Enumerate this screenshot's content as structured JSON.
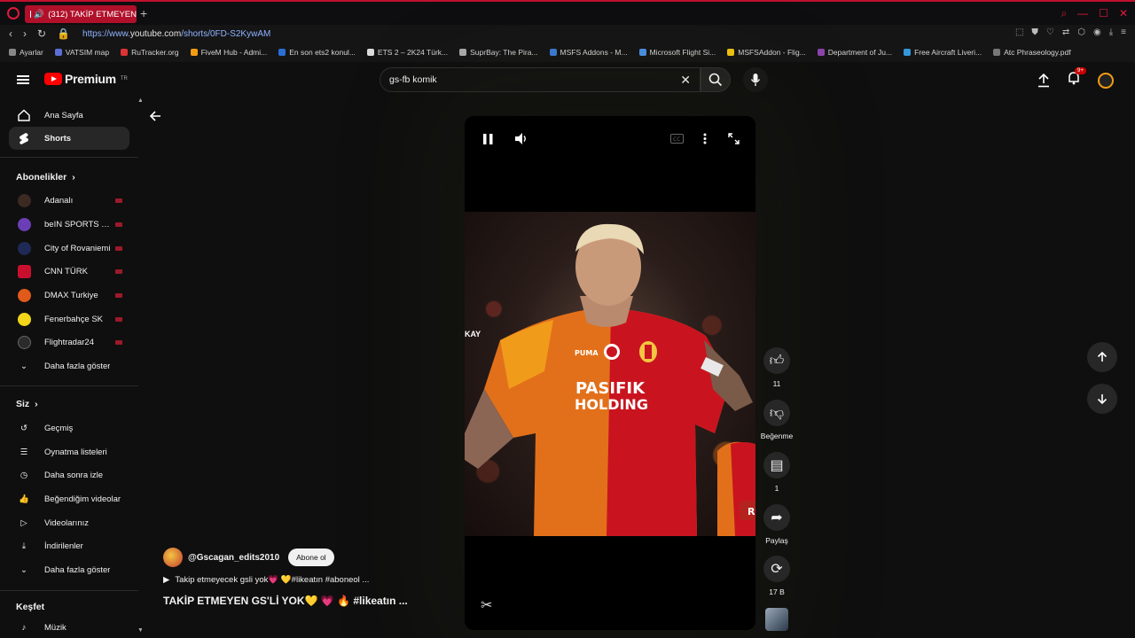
{
  "browser": {
    "tab_title": "(312) TAKİP ETMEYEN",
    "new_tab": "+",
    "url_scheme": "https://www.",
    "url_host": "youtube.com",
    "url_path": "/shorts/0FD-S2KywAM",
    "bookmarks": [
      "Ayarlar",
      "VATSIM map",
      "RuTracker.org",
      "FiveM Hub - Admi...",
      "En son ets2 konul...",
      "ETS 2 – 2K24 Türk...",
      "SuprBay: The Pira...",
      "MSFS Addons - M...",
      "Microsoft Flight Si...",
      "MSFSAddon - Flig...",
      "Department of Ju...",
      "Free Aircraft Liveri...",
      "Atc Phraseology.pdf"
    ]
  },
  "header": {
    "logo_text": "Premium",
    "logo_region": "TR",
    "search_value": "gs-fb komik",
    "notif_count": "9+"
  },
  "sidebar": {
    "home": "Ana Sayfa",
    "shorts": "Shorts",
    "subs_title": "Abonelikler",
    "channels": [
      {
        "name": "Adanalı",
        "color": "#3b2a22"
      },
      {
        "name": "beIN SPORTS Tü...",
        "color": "#6a3fb5"
      },
      {
        "name": "City of Rovaniemi",
        "color": "#1e2a55"
      },
      {
        "name": "CNN TÜRK",
        "color": "#c8102e"
      },
      {
        "name": "DMAX Turkiye",
        "color": "#e05a1b"
      },
      {
        "name": "Fenerbahçe SK",
        "color": "#f3d51a"
      },
      {
        "name": "Flightradar24",
        "color": "#2b2b2b"
      }
    ],
    "show_more": "Daha fazla göster",
    "you_title": "Siz",
    "you_items": [
      "Geçmiş",
      "Oynatma listeleri",
      "Daha sonra izle",
      "Beğendiğim videolar",
      "Videolarınız",
      "İndirilenler",
      "Daha fazla göster"
    ],
    "explore_title": "Keşfet",
    "explore_items": [
      "Müzik"
    ]
  },
  "player": {
    "overlay_text": "KAY",
    "jersey_line1": "PASIFIK",
    "jersey_line2": "HOLDING"
  },
  "actions": {
    "likes": "11",
    "dislike": "Beğenme",
    "comments": "1",
    "share": "Paylaş",
    "remix": "17 B"
  },
  "meta": {
    "channel": "@Gscagan_edits2010",
    "subscribe": "Abone ol",
    "description": "Takip etmeyecek gsli yok💗 💛#likeatın #aboneol ...",
    "title": "TAKİP ETMEYEN GS'Lİ YOK💛 💗 🔥 #likeatın ..."
  }
}
